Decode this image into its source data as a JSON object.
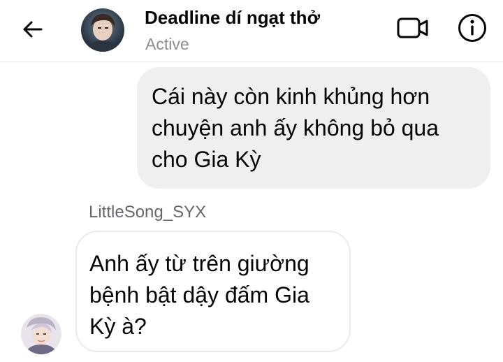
{
  "header": {
    "title": "Deadline dí ngạt thở",
    "status": "Active",
    "icons": {
      "back": "back-arrow-icon",
      "video": "video-call-icon",
      "info": "info-icon"
    }
  },
  "messages": [
    {
      "direction": "outgoing",
      "lines": [
        "Cái này còn kinh khủng hơn",
        "chuyện anh ấy không bỏ qua",
        "cho Gia Kỳ"
      ]
    },
    {
      "direction": "incoming",
      "sender": "LittleSong_SYX",
      "lines": [
        "Anh ấy từ trên giường",
        "bệnh bật dậy đấm Gia",
        "Kỳ à?"
      ]
    }
  ],
  "colors": {
    "outgoing_bubble": "#efefef",
    "incoming_border": "#ebebeb",
    "secondary_text": "#65676b",
    "status_text": "#8a8d91"
  }
}
